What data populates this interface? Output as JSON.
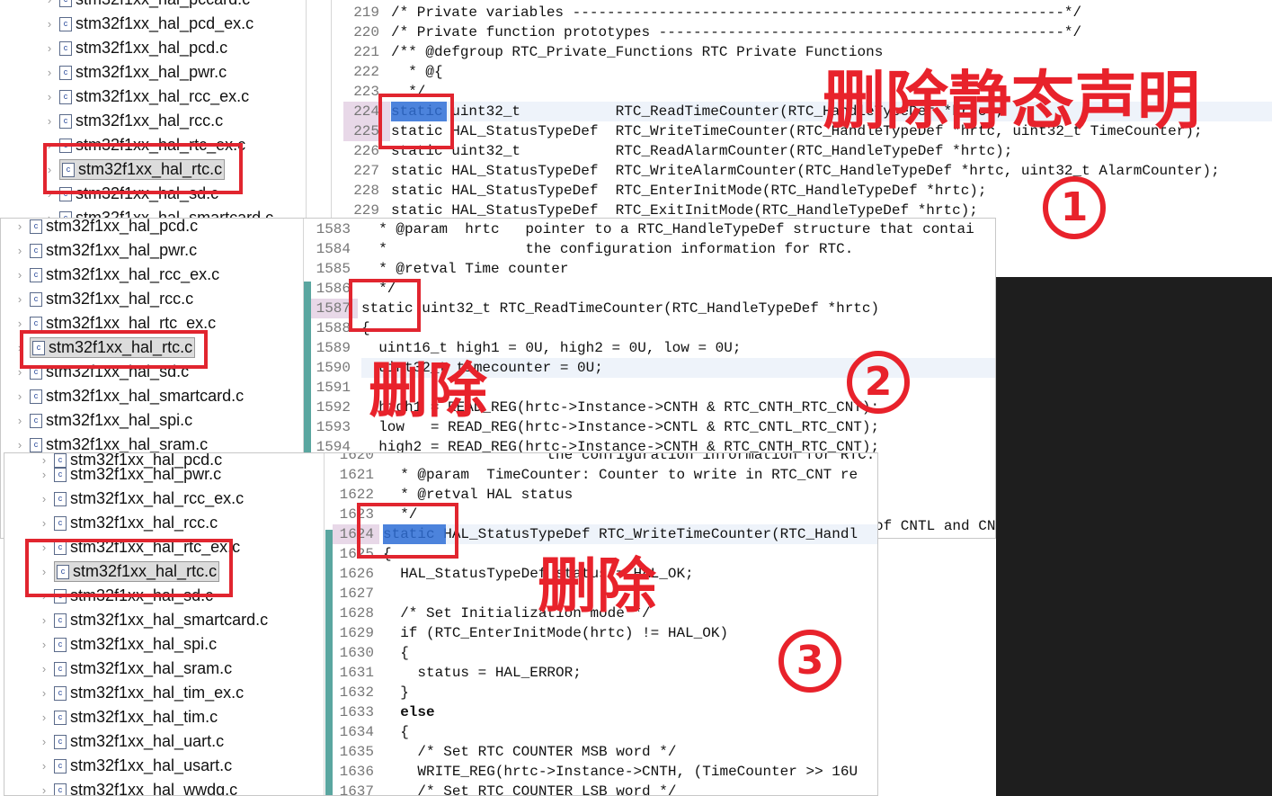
{
  "panel1": {
    "tree": [
      {
        "label": "stm32f1xx_hal_pccard.c",
        "selected": false
      },
      {
        "label": "stm32f1xx_hal_pcd_ex.c",
        "selected": false
      },
      {
        "label": "stm32f1xx_hal_pcd.c",
        "selected": false
      },
      {
        "label": "stm32f1xx_hal_pwr.c",
        "selected": false
      },
      {
        "label": "stm32f1xx_hal_rcc_ex.c",
        "selected": false
      },
      {
        "label": "stm32f1xx_hal_rcc.c",
        "selected": false
      },
      {
        "label": "stm32f1xx_hal_rtc_ex.c",
        "selected": false
      },
      {
        "label": "stm32f1xx_hal_rtc.c",
        "selected": true
      },
      {
        "label": "stm32f1xx_hal_sd.c",
        "selected": false
      },
      {
        "label": "stm32f1xx_hal_smartcard.c",
        "selected": false
      }
    ],
    "line_numbers": [
      "219",
      "220",
      "221",
      "222",
      "223",
      "224",
      "225",
      "226",
      "227",
      "228",
      "229"
    ],
    "code": [
      "/* Private variables ---------------------------------------------------------*/",
      "/* Private function prototypes -----------------------------------------------*/",
      "/** @defgroup RTC_Private_Functions RTC Private Functions",
      "  * @{",
      "  */",
      "static uint32_t           RTC_ReadTimeCounter(RTC_HandleTypeDef *hrtc);",
      "static HAL_StatusTypeDef  RTC_WriteTimeCounter(RTC_HandleTypeDef *hrtc, uint32_t TimeCounter);",
      "static uint32_t           RTC_ReadAlarmCounter(RTC_HandleTypeDef *hrtc);",
      "static HAL_StatusTypeDef  RTC_WriteAlarmCounter(RTC_HandleTypeDef *hrtc, uint32_t AlarmCounter);",
      "static HAL_StatusTypeDef  RTC_EnterInitMode(RTC_HandleTypeDef *hrtc);",
      "static HAL_StatusTypeDef  RTC_ExitInitMode(RTC_HandleTypeDef *hrtc);"
    ]
  },
  "panel2": {
    "tree": [
      {
        "label": "stm32f1xx_hal_pcd.c",
        "selected": false
      },
      {
        "label": "stm32f1xx_hal_pwr.c",
        "selected": false
      },
      {
        "label": "stm32f1xx_hal_rcc_ex.c",
        "selected": false
      },
      {
        "label": "stm32f1xx_hal_rcc.c",
        "selected": false
      },
      {
        "label": "stm32f1xx_hal_rtc_ex.c",
        "selected": false
      },
      {
        "label": "stm32f1xx_hal_rtc.c",
        "selected": true
      },
      {
        "label": "stm32f1xx_hal_sd.c",
        "selected": false
      },
      {
        "label": "stm32f1xx_hal_smartcard.c",
        "selected": false
      },
      {
        "label": "stm32f1xx_hal_spi.c",
        "selected": false
      },
      {
        "label": "stm32f1xx_hal_sram.c",
        "selected": false
      }
    ],
    "line_numbers": [
      "1583",
      "1584",
      "1585",
      "1586",
      "1587",
      "1588",
      "1589",
      "1590",
      "1591",
      "1592",
      "1593",
      "1594"
    ],
    "code": [
      "  * @param  hrtc   pointer to a RTC_HandleTypeDef structure that contai",
      "  *                the configuration information for RTC.",
      "  * @retval Time counter",
      "  */",
      "static uint32_t RTC_ReadTimeCounter(RTC_HandleTypeDef *hrtc)",
      "{",
      "  uint16_t high1 = 0U, high2 = 0U, low = 0U;",
      "  uint32_t timecounter = 0U;",
      "",
      "  high1 = READ_REG(hrtc->Instance->CNTH & RTC_CNTH_RTC_CNT);",
      "  low   = READ_REG(hrtc->Instance->CNTL & RTC_CNTL_RTC_CNT);",
      "  high2 = READ_REG(hrtc->Instance->CNTH & RTC_CNTH_RTC_CNT);"
    ],
    "tail_fragment": "of CNTL and CN"
  },
  "panel3": {
    "tree": [
      {
        "label": "stm32f1xx_hal_pcd.c",
        "selected": false
      },
      {
        "label": "stm32f1xx_hal_pwr.c",
        "selected": false
      },
      {
        "label": "stm32f1xx_hal_rcc_ex.c",
        "selected": false
      },
      {
        "label": "stm32f1xx_hal_rcc.c",
        "selected": false
      },
      {
        "label": "stm32f1xx_hal_rtc_ex.c",
        "selected": false
      },
      {
        "label": "stm32f1xx_hal_rtc.c",
        "selected": true
      },
      {
        "label": "stm32f1xx_hal_sd.c",
        "selected": false
      },
      {
        "label": "stm32f1xx_hal_smartcard.c",
        "selected": false
      },
      {
        "label": "stm32f1xx_hal_spi.c",
        "selected": false
      },
      {
        "label": "stm32f1xx_hal_sram.c",
        "selected": false
      },
      {
        "label": "stm32f1xx_hal_tim_ex.c",
        "selected": false
      },
      {
        "label": "stm32f1xx_hal_tim.c",
        "selected": false
      },
      {
        "label": "stm32f1xx_hal_uart.c",
        "selected": false
      },
      {
        "label": "stm32f1xx_hal_usart.c",
        "selected": false
      },
      {
        "label": "stm32f1xx_hal_wwdg.c",
        "selected": false
      }
    ],
    "line_numbers": [
      "1620",
      "1621",
      "1622",
      "1623",
      "1624",
      "1625",
      "1626",
      "1627",
      "1628",
      "1629",
      "1630",
      "1631",
      "1632",
      "1633",
      "1634",
      "1635",
      "1636",
      "1637"
    ],
    "code": [
      "  *                the configuration information for RTC.",
      "  * @param  TimeCounter: Counter to write in RTC_CNT re",
      "  * @retval HAL status",
      "  */",
      "static HAL_StatusTypeDef RTC_WriteTimeCounter(RTC_Handl",
      "{",
      "  HAL_StatusTypeDef status = HAL_OK;",
      "",
      "  /* Set Initialization mode */",
      "  if (RTC_EnterInitMode(hrtc) != HAL_OK)",
      "  {",
      "    status = HAL_ERROR;",
      "  }",
      "  else",
      "  {",
      "    /* Set RTC COUNTER MSB word */",
      "    WRITE_REG(hrtc->Instance->CNTH, (TimeCounter >> 16U",
      "    /* Set RTC COUNTER LSB word */"
    ]
  },
  "annotations": {
    "step1_text": "删除静态声明",
    "step1_num": "①",
    "step2_text": "删除",
    "step2_num": "②",
    "step3_text": "删除",
    "step3_num": "③"
  },
  "colors": {
    "annotation_red": "#e8222b",
    "selection_blue": "#2f6fd6"
  }
}
